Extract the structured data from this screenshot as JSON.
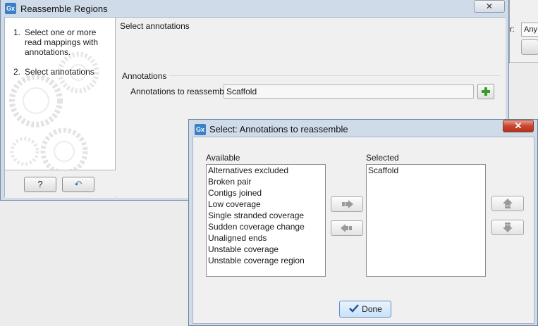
{
  "background_window": {
    "select_value": "Any"
  },
  "main_window": {
    "title": "Reassemble Regions",
    "close_glyph": "✕",
    "steps": [
      {
        "num": "1.",
        "label": "Select one or more read mappings with annotations."
      },
      {
        "num": "2.",
        "label": "Select annotations"
      }
    ],
    "help_label": "?",
    "reset_glyph": "↶",
    "section_title": "Select annotations",
    "group_title": "Annotations",
    "field_label": "Annotations to reassemble",
    "field_value": "Scaffold"
  },
  "dialog": {
    "title": "Select: Annotations to reassemble",
    "close_glyph": "✕",
    "available_label": "Available",
    "selected_label": "Selected",
    "available_items": [
      "Alternatives excluded",
      "Broken pair",
      "Contigs joined",
      "Low coverage",
      "Single stranded coverage",
      "Sudden coverage change",
      "Unaligned ends",
      "Unstable coverage",
      "Unstable coverage region"
    ],
    "selected_items": [
      "Scaffold"
    ],
    "done_label": "Done"
  },
  "icons": {
    "app": "Gx",
    "add": "plus-icon",
    "move_right": "arrow-right-icon",
    "move_left": "arrow-left-icon",
    "move_up": "arrow-up-icon",
    "move_down": "arrow-down-icon",
    "done": "checkmark-icon"
  },
  "colors": {
    "title_bar": "#cfdbe9",
    "close_red": "#c8462f",
    "plus_green": "#3a9b2a",
    "done_check": "#1f4f9a"
  }
}
